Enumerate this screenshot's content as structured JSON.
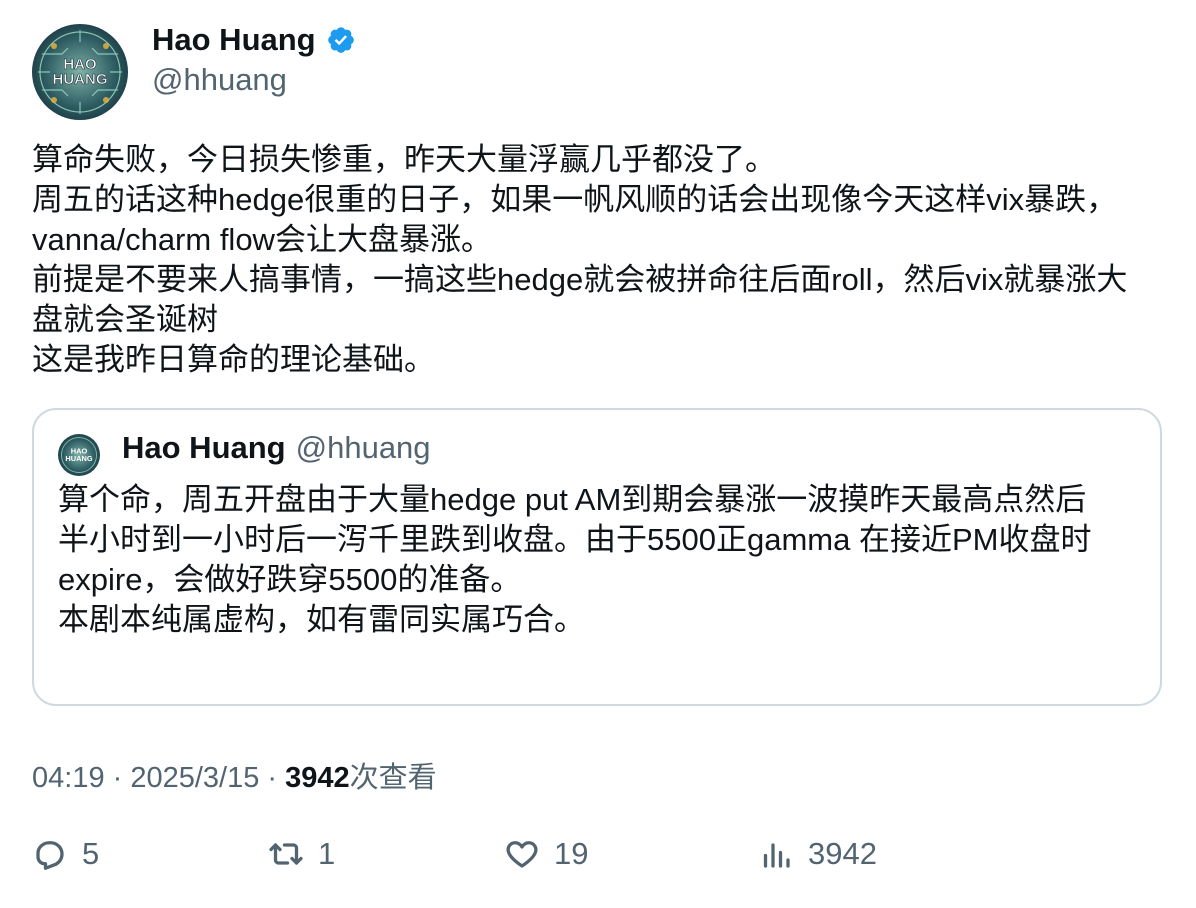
{
  "author": {
    "name": "Hao Huang",
    "handle": "@hhuang",
    "avatar_text_line1": "HAO",
    "avatar_text_line2": "HUANG"
  },
  "tweet": {
    "text": "算命失败，今日损失惨重，昨天大量浮赢几乎都没了。\n周五的话这种hedge很重的日子，如果一帆风顺的话会出现像今天这样vix暴跌，\nvanna/charm flow会让大盘暴涨。\n前提是不要来人搞事情，一搞这些hedge就会被拼命往后面roll，然后vix就暴涨大\n盘就会圣诞树\n这是我昨日算命的理论基础。"
  },
  "quoted": {
    "name": "Hao Huang",
    "handle": "@hhuang",
    "text": "算个命，周五开盘由于大量hedge put AM到期会暴涨一波摸昨天最高点然后\n半小时到一小时后一泻千里跌到收盘。由于5500正gamma 在接近PM收盘时\nexpire，会做好跌穿5500的准备。\n本剧本纯属虚构，如有雷同实属巧合。"
  },
  "meta": {
    "time": "04:19",
    "separator1": " · ",
    "date": "2025/3/15",
    "separator2": " · ",
    "views_count": "3942",
    "views_label": "次查看"
  },
  "actions": {
    "replies": "5",
    "retweets": "1",
    "likes": "19",
    "views": "3942"
  },
  "colors": {
    "text": "#0f1419",
    "secondary": "#536471",
    "border": "#cfd9de",
    "verified": "#1d9bf0"
  }
}
